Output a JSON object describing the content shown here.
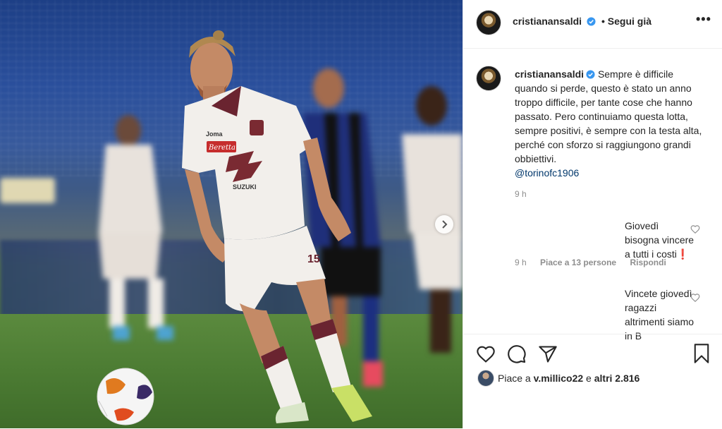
{
  "post": {
    "username": "cristianansaldi",
    "follow_label": "Segui già",
    "more_label": "•••",
    "caption": "Sempre è difficile quando si perde, questo è stato un anno troppo difficile, per tante cose che hanno passato. Pero continuiamo questa lotta, sempre positivi, è sempre con la testa alta, perché con sforzo si raggiungono grandi obbiettivi.",
    "mention": "@torinofc1906",
    "time": "9 h"
  },
  "comments": [
    {
      "text": "Giovedì bisogna vincere a tutti i costi❗",
      "time": "9 h",
      "likes_label": "Piace a 13 persone",
      "reply_label": "Rispondi"
    },
    {
      "text": "Vincete giovedì ragazzi altrimenti siamo in B"
    }
  ],
  "likes": {
    "prefix": "Piace a",
    "user": "v.millico22",
    "mid": "e",
    "others": "altri 2.816"
  },
  "icons": {
    "like": "heart-icon",
    "comment": "comment-icon",
    "share": "share-icon",
    "save": "bookmark-icon",
    "verified": "verified-badge-icon",
    "next": "chevron-right-icon"
  },
  "colors": {
    "verified": "#3897f0",
    "mention": "#00376b",
    "muted": "#8e8e8e"
  }
}
